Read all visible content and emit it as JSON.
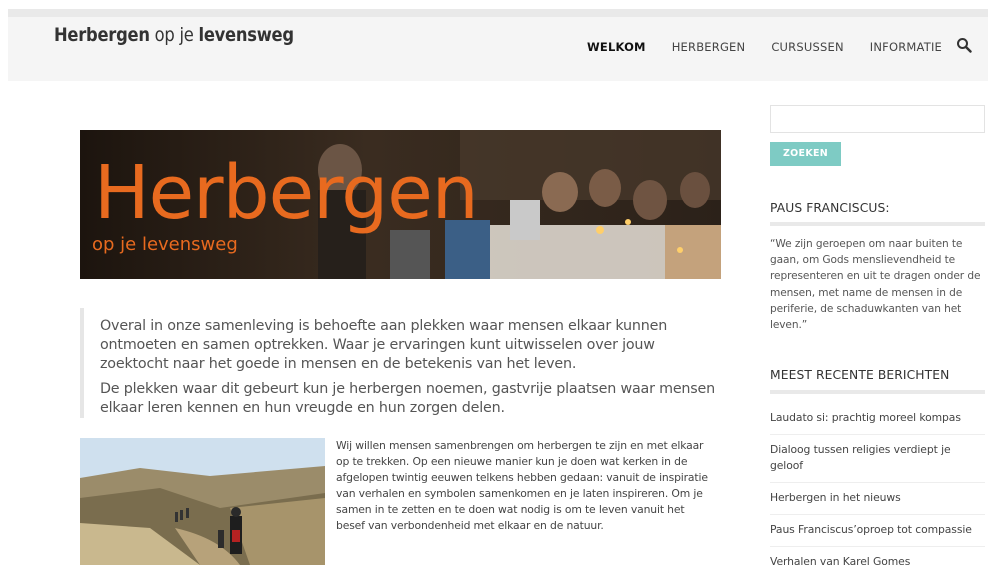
{
  "site": {
    "logo_bold_1": "Herbergen",
    "logo_light": " op je ",
    "logo_bold_2": "levensweg"
  },
  "nav": {
    "items": [
      "WELKOM",
      "HERBERGEN",
      "CURSUSSEN",
      "INFORMATIE"
    ],
    "active_index": 0,
    "search_icon": "search-icon"
  },
  "hero": {
    "title": "Herbergen",
    "subtitle": "op je levensweg",
    "title_color": "#e86a1f"
  },
  "intro": {
    "p1": "Overal in onze samenleving is behoefte aan plekken waar mensen elkaar kunnen ontmoeten en samen optrekken. Waar je ervaringen kunt uitwisselen over jouw zoektocht naar het goede in mensen en de betekenis van het leven.",
    "p2": "De plekken waar dit gebeurt kun je herbergen noemen, gastvrije plaatsen waar mensen elkaar leren kennen en hun vreugde en hun zorgen delen."
  },
  "body": {
    "text": "Wij willen mensen samenbrengen om herbergen te zijn en met elkaar op te trekken. Op een nieuwe manier kun je doen wat kerken in de afgelopen twintig eeuwen telkens hebben gedaan: vanuit de inspiratie van verhalen en symbolen samenkomen en je laten inspireren. Om je samen in te zetten en te doen wat nodig is om te leven vanuit het besef van verbondenheid met elkaar en de natuur."
  },
  "sidebar": {
    "search_value": "",
    "search_button": "ZOEKEN",
    "button_color": "#7ecbc4",
    "pope_title": "PAUS FRANCISCUS:",
    "pope_quote": "“We zijn geroepen om naar buiten te gaan, om Gods mensliev­endheid te representeren en uit te dragen onder de mensen, met name de mensen in de periferie, de schaduwkanten van het leven.”",
    "recent_title": "MEEST RECENTE BERICHTEN",
    "recent_posts": [
      "Laudato si: prachtig moreel kompas",
      "Dialoog tussen religies verdiept je geloof",
      "Herbergen in het nieuws",
      "Paus Franciscus’oproep tot compassie",
      "Verhalen van Karel Gomes"
    ]
  }
}
